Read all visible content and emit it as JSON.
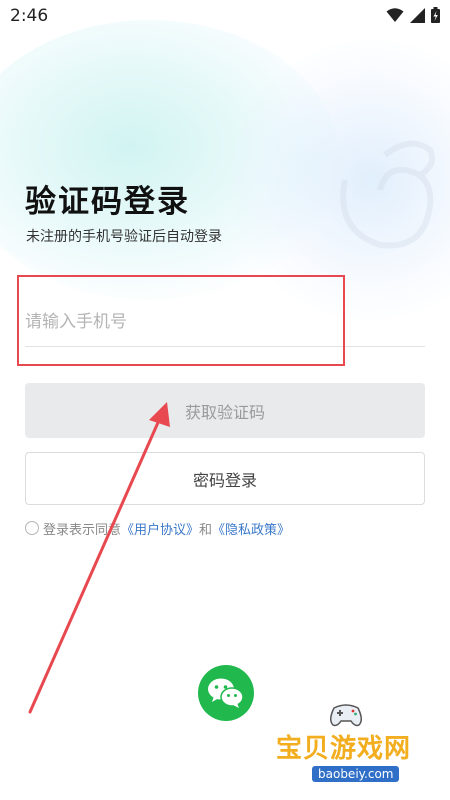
{
  "status_bar": {
    "time": "2:46"
  },
  "login": {
    "title": "验证码登录",
    "subtitle": "未注册的手机号验证后自动登录",
    "phone_placeholder": "请输入手机号",
    "phone_value": "",
    "get_code_label": "获取验证码",
    "password_login_label": "密码登录"
  },
  "agreement": {
    "prefix": "登录表示同意",
    "user_agreement": "《用户协议》",
    "and": "和",
    "privacy_policy": "《隐私政策》"
  },
  "watermark": {
    "brand": "宝贝游戏网",
    "url": "baobeiy.com"
  },
  "colors": {
    "accent_link": "#3a78c9",
    "wechat_green": "#21b94e",
    "annotation_red": "#e8484f",
    "disabled_button_bg": "#e8eaec"
  },
  "icons": [
    "wifi-icon",
    "signal-icon",
    "battery-icon",
    "wechat-icon",
    "gamepad-icon"
  ]
}
